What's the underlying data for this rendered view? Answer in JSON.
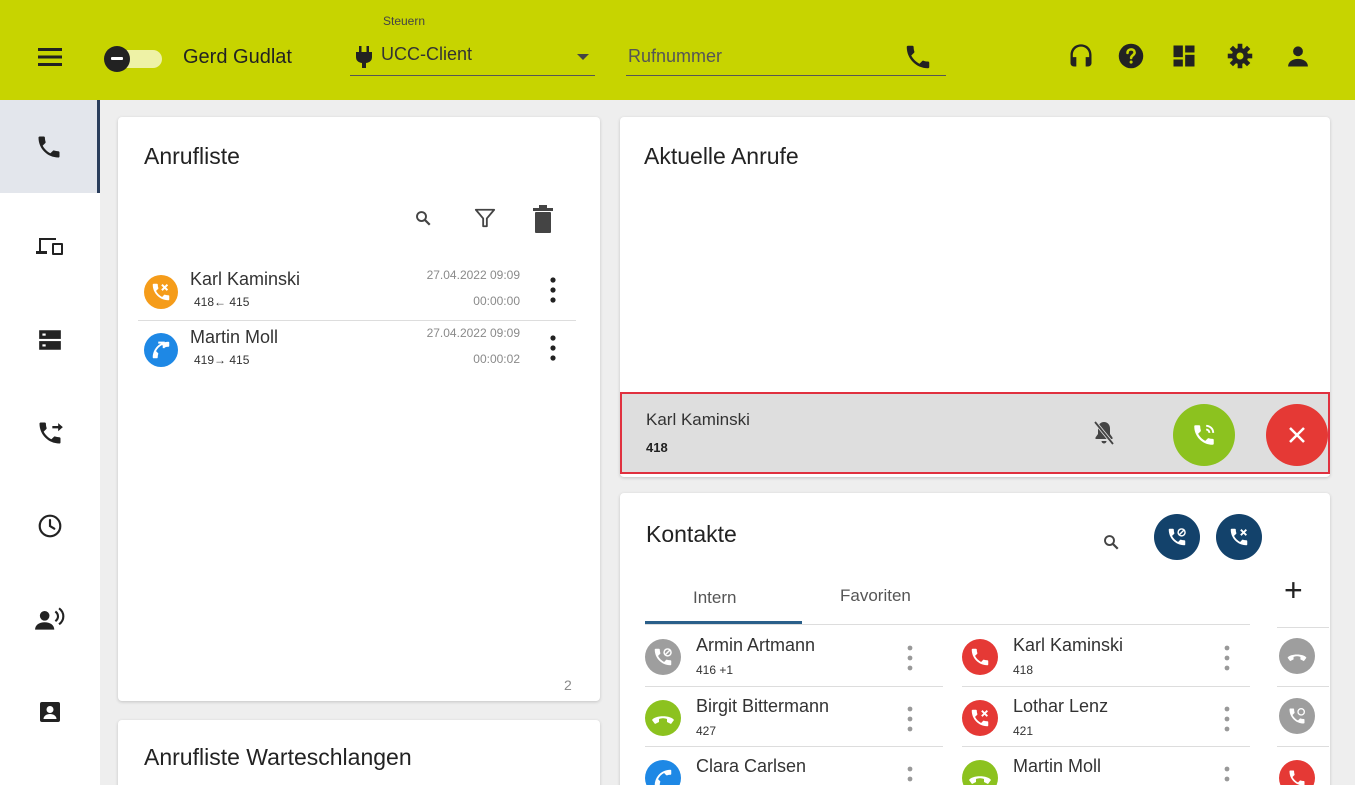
{
  "header": {
    "user_name": "Gerd Gudlat",
    "control_label": "Steuern",
    "client_value": "UCC-Client",
    "number_placeholder": "Rufnummer"
  },
  "icons": {
    "menu": "menu-icon",
    "presence_toggle": "toggle-icon",
    "client": "plug-icon",
    "dial": "phone-icon",
    "headset": "headset-icon",
    "help": "help-icon",
    "dashboard": "dashboard-icon",
    "settings": "gear-icon",
    "profile": "person-icon"
  },
  "sidebar": {
    "items": [
      {
        "id": "phone",
        "icon": "phone-icon",
        "active": true
      },
      {
        "id": "devices",
        "icon": "devices-icon",
        "active": false
      },
      {
        "id": "server",
        "icon": "server-icon",
        "active": false
      },
      {
        "id": "forward",
        "icon": "call-forward-icon",
        "active": false
      },
      {
        "id": "history",
        "icon": "clock-icon",
        "active": false
      },
      {
        "id": "voice",
        "icon": "speaker-person-icon",
        "active": false
      },
      {
        "id": "contacts",
        "icon": "contact-card-icon",
        "active": false
      }
    ]
  },
  "call_list": {
    "title": "Anrufliste",
    "count": "2",
    "entries": [
      {
        "name": "Karl Kaminski",
        "route": "418← 415",
        "date": "27.04.2022 09:09",
        "duration": "00:00:00",
        "status": "missed",
        "color": "#f59c1a"
      },
      {
        "name": "Martin Moll",
        "route": "419→ 415",
        "date": "27.04.2022 09:09",
        "duration": "00:00:02",
        "status": "outgoing",
        "color": "#1e88e5"
      }
    ]
  },
  "queue_list": {
    "title": "Anrufliste Warteschlangen"
  },
  "current_calls": {
    "title": "Aktuelle Anrufe",
    "incoming": {
      "name": "Karl Kaminski",
      "number": "418"
    }
  },
  "contacts": {
    "title": "Kontakte",
    "tabs": [
      {
        "label": "Intern",
        "active": true
      },
      {
        "label": "Favoriten",
        "active": false
      }
    ],
    "add_label": "+",
    "left": [
      {
        "name": "Armin Artmann",
        "sub": "416 +1",
        "color": "#9e9e9e",
        "icon": "call-status-icon"
      },
      {
        "name": "Birgit Bittermann",
        "sub": "427",
        "color": "#8cc21f",
        "icon": "handset-icon"
      },
      {
        "name": "Clara Carlsen",
        "sub": "",
        "color": "#1e88e5",
        "icon": "call-outgoing-icon"
      }
    ],
    "right": [
      {
        "name": "Karl Kaminski",
        "sub": "418",
        "color": "#e53935",
        "icon": "phone-icon"
      },
      {
        "name": "Lothar Lenz",
        "sub": "421",
        "color": "#e53935",
        "icon": "call-blocked-icon"
      },
      {
        "name": "Martin Moll",
        "sub": "",
        "color": "#8cc21f",
        "icon": "handset-icon"
      }
    ],
    "side_status_colors": [
      "#9e9e9e",
      "#9e9e9e",
      "#e53935"
    ]
  },
  "colors": {
    "topbar": "#c7d400",
    "accept": "#8cc21f",
    "reject": "#e53935",
    "navy": "#13426b",
    "highlight_border": "#e0313f"
  }
}
